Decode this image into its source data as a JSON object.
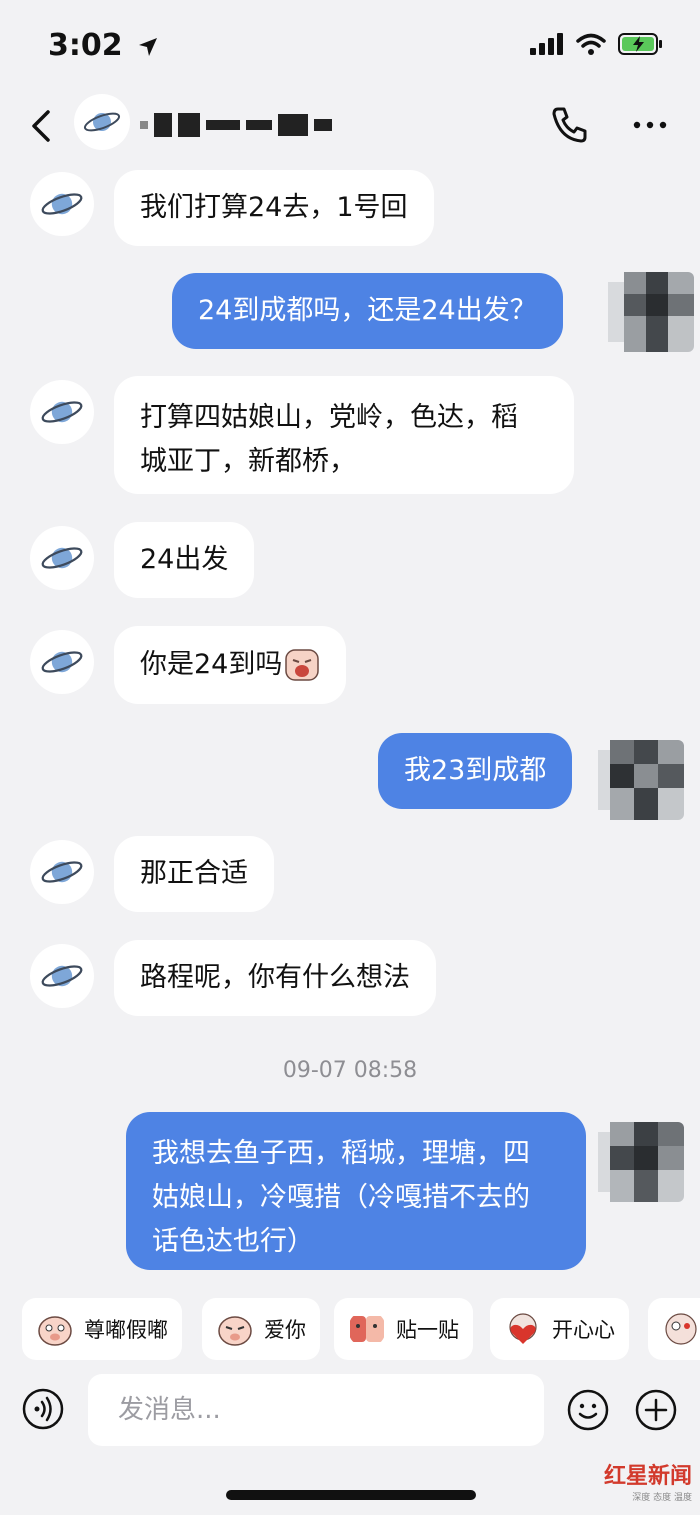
{
  "status_bar": {
    "time": "3:02"
  },
  "header": {
    "title_masked": true
  },
  "messages": [
    {
      "side": "in",
      "lines": [
        "我们打算24去，1号回"
      ]
    },
    {
      "side": "out",
      "lines": [
        "24到成都吗，还是24出发？"
      ]
    },
    {
      "side": "in",
      "lines": [
        "打算四姑娘山，党岭，色达，稻",
        "城亚丁，新都桥，"
      ]
    },
    {
      "side": "in",
      "lines": [
        "24出发"
      ]
    },
    {
      "side": "in",
      "lines": [
        "你是24到吗"
      ]
    },
    {
      "side": "out",
      "lines": [
        "我23到成都"
      ]
    },
    {
      "side": "in",
      "lines": [
        "那正合适"
      ]
    },
    {
      "side": "in",
      "lines": [
        "路程呢，你有什么想法"
      ]
    },
    {
      "side": "out",
      "lines": [
        "我想去鱼子西，稻城，理塘，四",
        "姑娘山，冷嘎措（冷嘎措不去的",
        "话色达也行）"
      ]
    }
  ],
  "timestamp": "09-07 08:58",
  "stickers": [
    "尊嘟假嘟",
    "爱你",
    "贴一贴",
    "开心心"
  ],
  "input": {
    "placeholder": "发消息..."
  },
  "watermark": {
    "text": "红星新闻",
    "sub": "深度 态度 温度"
  },
  "colors": {
    "outgoing_bubble": "#4e83e4",
    "incoming_bubble": "#ffffff",
    "background": "#f2f2f4"
  }
}
